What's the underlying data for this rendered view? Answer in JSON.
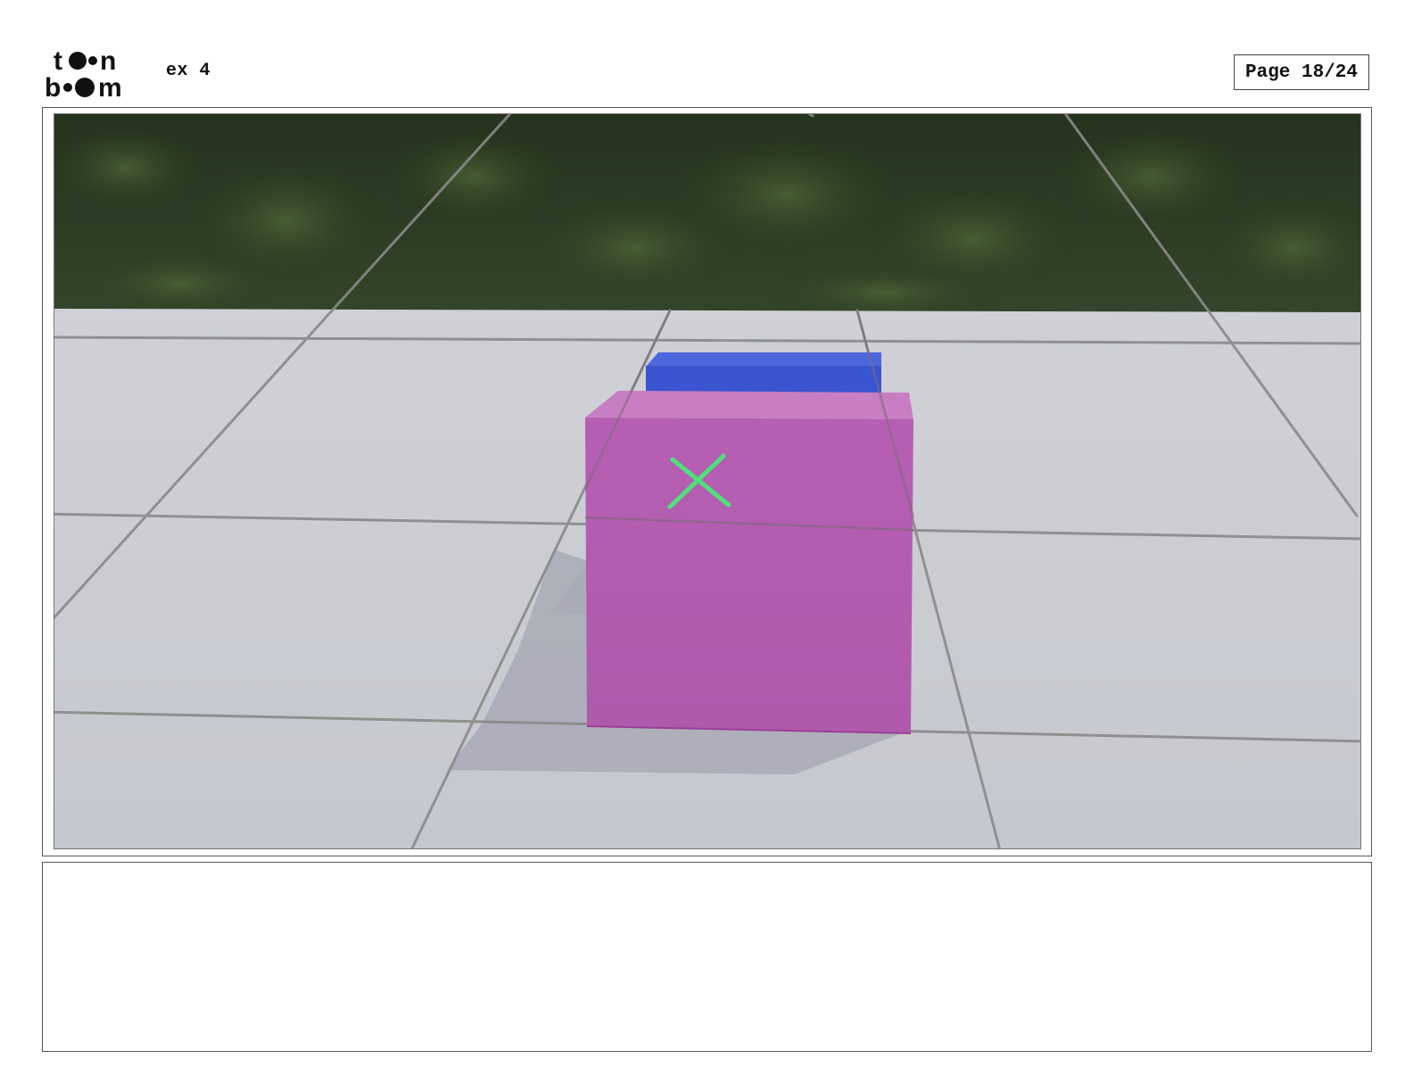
{
  "header": {
    "logo_text_line1": "toon",
    "logo_text_line2": "boom",
    "project_title": "ex 4",
    "page_label": "Page 18/24"
  },
  "panel": {
    "description_icons": [
      "background-foliage",
      "floor-grid",
      "magenta-cube",
      "blue-box",
      "green-x-mark"
    ],
    "colors": {
      "foliage_dark": "#1f2a18",
      "foliage_mid": "#2f4226",
      "floor": "#c9cbd1",
      "grid_line": "#8a8a8a",
      "cube_front": "#b35cb0",
      "cube_top": "#c97cc4",
      "box_blue": "#3c57d0",
      "x_mark": "#4ee07a",
      "shadow": "#a9aab5"
    }
  },
  "caption": {
    "text": ""
  }
}
